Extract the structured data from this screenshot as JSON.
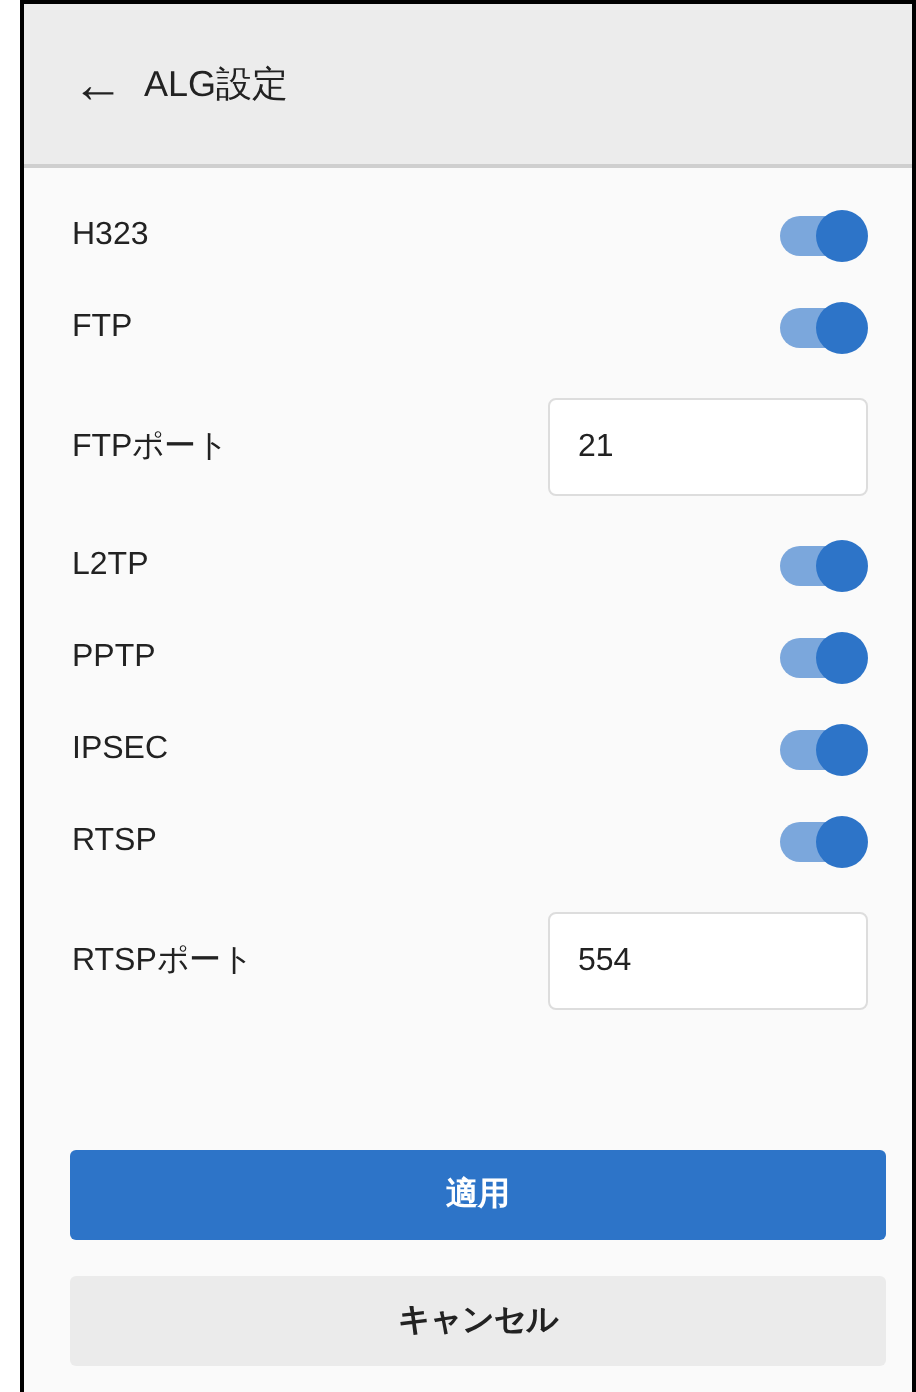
{
  "header": {
    "back_icon": "←",
    "title": "ALG設定"
  },
  "settings": [
    {
      "kind": "toggle",
      "label": "H323",
      "on": true
    },
    {
      "kind": "toggle",
      "label": "FTP",
      "on": true
    },
    {
      "kind": "field",
      "label": "FTPポート",
      "value": "21"
    },
    {
      "kind": "toggle",
      "label": "L2TP",
      "on": true
    },
    {
      "kind": "toggle",
      "label": "PPTP",
      "on": true
    },
    {
      "kind": "toggle",
      "label": "IPSEC",
      "on": true
    },
    {
      "kind": "toggle",
      "label": "RTSP",
      "on": true
    },
    {
      "kind": "field",
      "label": "RTSPポート",
      "value": "554"
    }
  ],
  "buttons": [
    {
      "kind": "primary",
      "label": "適用"
    },
    {
      "kind": "secondary",
      "label": "キャンセル"
    }
  ]
}
